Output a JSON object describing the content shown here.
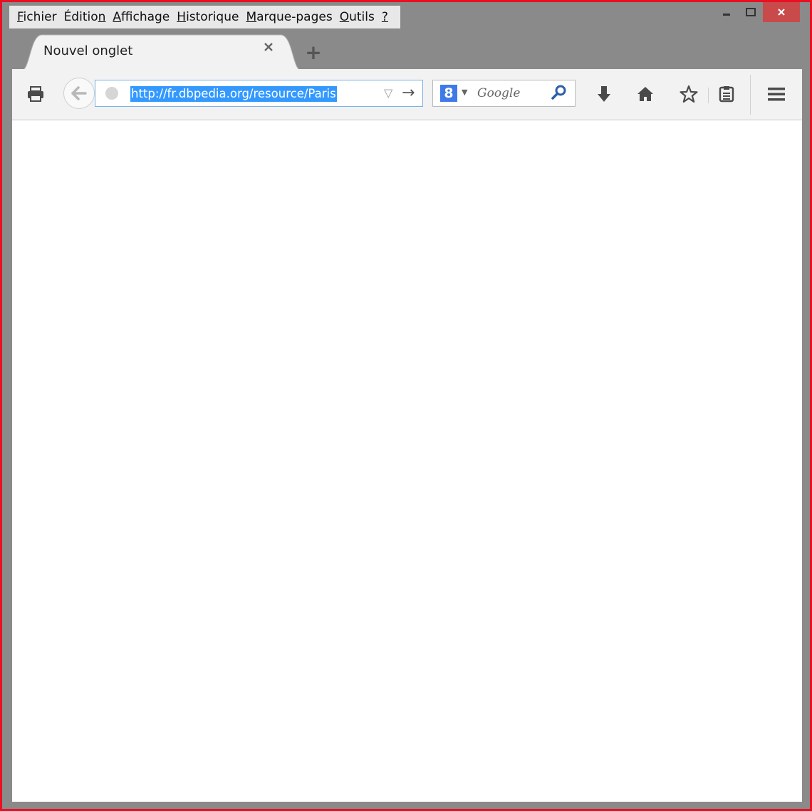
{
  "menubar": {
    "items": [
      {
        "label": "Fichier",
        "accel": "F",
        "rest": "ichier"
      },
      {
        "label": "Édition",
        "accel_pre": "Éditio",
        "accel": "n"
      },
      {
        "label": "Affichage",
        "accel": "A",
        "rest": "ffichage"
      },
      {
        "label": "Historique",
        "accel": "H",
        "rest": "istorique"
      },
      {
        "label": "Marque-pages",
        "accel": "M",
        "rest": "arque-pages"
      },
      {
        "label": "Outils",
        "accel": "O",
        "rest": "utils"
      },
      {
        "label": "?",
        "accel": "?"
      }
    ]
  },
  "tabs": [
    {
      "title": "Nouvel onglet",
      "close_icon": "close-icon"
    }
  ],
  "newtab": {
    "icon": "plus-icon",
    "glyph": "+"
  },
  "toolbar": {
    "url": "http://fr.dbpedia.org/resource/Paris",
    "search_engine_letter": "8",
    "search_placeholder": "Google"
  },
  "colors": {
    "window_border": "#e81123",
    "chrome_bg": "#8a8a8a",
    "selection": "#3399ff",
    "close_button": "#c94a4a"
  }
}
